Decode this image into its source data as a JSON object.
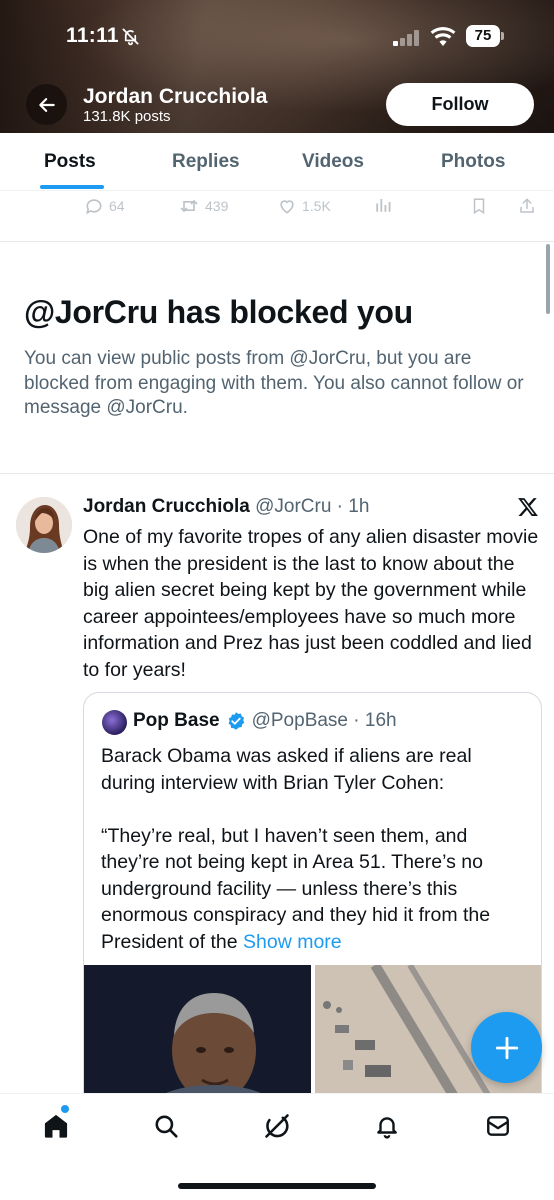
{
  "status_bar": {
    "time": "11:11",
    "battery": "75"
  },
  "profile": {
    "name": "Jordan Crucchiola",
    "posts_count": "131.8K posts",
    "follow_label": "Follow"
  },
  "tabs": [
    {
      "label": "Posts",
      "active": true
    },
    {
      "label": "Replies",
      "active": false
    },
    {
      "label": "Videos",
      "active": false
    },
    {
      "label": "Photos",
      "active": false
    }
  ],
  "faded_actions": {
    "replies": "64",
    "reposts": "439",
    "likes": "1.5K"
  },
  "blocked_notice": {
    "title": "@JorCru has blocked you",
    "description": "You can view public posts from @JorCru, but you are blocked from engaging with them. You also cannot follow or message @JorCru."
  },
  "tweet": {
    "name": "Jordan Crucchiola",
    "handle": "@JorCru",
    "time": "1h",
    "text": "One of my favorite tropes of any alien disaster movie is when the president is the last to know about the big alien secret being kept by the government while career appointees/employees have so much more information and Prez has just been coddled and lied to for years!"
  },
  "quote": {
    "name": "Pop Base",
    "handle": "@PopBase",
    "time": "16h",
    "text_p1": "Barack Obama was asked if aliens are real during interview with Brian Tyler Cohen:",
    "text_p2": "“They’re real, but I haven’t seen them, and they’re not being kept in Area 51. There’s no underground facility — unless there’s this enormous conspiracy and they hid it from the President of the ",
    "show_more": "Show more"
  },
  "icons": {
    "back": "arrow-left-icon",
    "fab": "plus-icon",
    "nav": [
      "home-icon",
      "search-icon",
      "grok-icon",
      "notifications-icon",
      "messages-icon"
    ]
  },
  "colors": {
    "accent": "#1d9bf0",
    "text_primary": "#0f1419",
    "text_secondary": "#536471"
  }
}
